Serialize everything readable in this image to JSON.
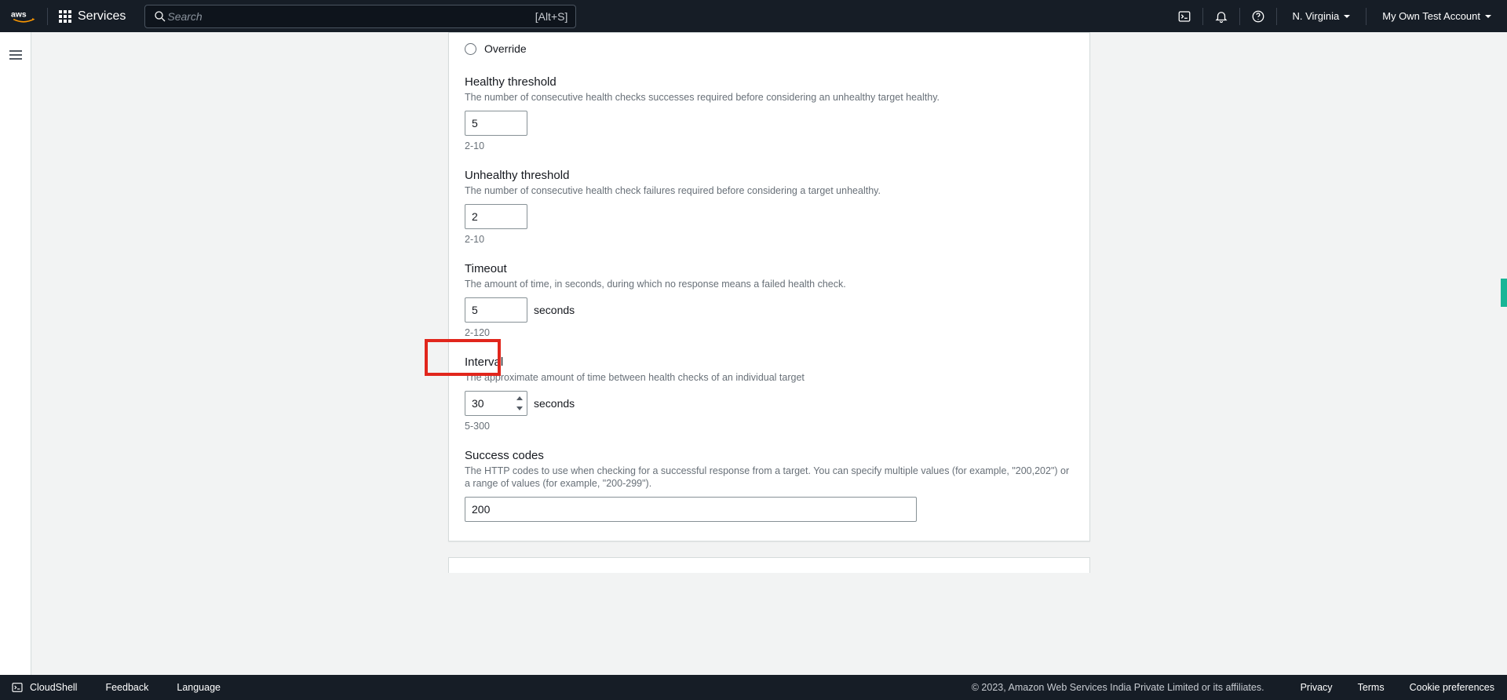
{
  "header": {
    "services_label": "Services",
    "search_placeholder": "Search",
    "search_shortcut": "[Alt+S]",
    "region": "N. Virginia",
    "account": "My Own Test Account"
  },
  "form": {
    "override": {
      "label": "Override"
    },
    "healthy": {
      "label": "Healthy threshold",
      "help": "The number of consecutive health checks successes required before considering an unhealthy target healthy.",
      "value": "5",
      "range": "2-10"
    },
    "unhealthy": {
      "label": "Unhealthy threshold",
      "help": "The number of consecutive health check failures required before considering a target unhealthy.",
      "value": "2",
      "range": "2-10"
    },
    "timeout": {
      "label": "Timeout",
      "help": "The amount of time, in seconds, during which no response means a failed health check.",
      "value": "5",
      "unit": "seconds",
      "range": "2-120"
    },
    "interval": {
      "label": "Interval",
      "help": "The approximate amount of time between health checks of an individual target",
      "value": "30",
      "unit": "seconds",
      "range": "5-300"
    },
    "success": {
      "label": "Success codes",
      "help": "The HTTP codes to use when checking for a successful response from a target. You can specify multiple values (for example, \"200,202\") or a range of values (for example, \"200-299\").",
      "value": "200"
    }
  },
  "footer": {
    "cloudshell": "CloudShell",
    "feedback": "Feedback",
    "language": "Language",
    "copyright": "© 2023, Amazon Web Services India Private Limited or its affiliates.",
    "privacy": "Privacy",
    "terms": "Terms",
    "cookies": "Cookie preferences"
  }
}
